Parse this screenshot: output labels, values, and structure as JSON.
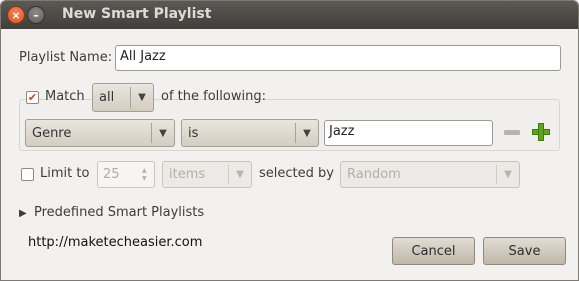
{
  "window": {
    "title": "New Smart Playlist",
    "close_glyph": "×",
    "minimize_glyph": "–"
  },
  "name_row": {
    "label": "Playlist Name:",
    "value": "All Jazz"
  },
  "match_row": {
    "checked": true,
    "check_glyph": "✔",
    "label": "Match",
    "mode": "all",
    "suffix": "of the following:"
  },
  "rule": {
    "field": "Genre",
    "operator": "is",
    "value": "Jazz"
  },
  "limit_row": {
    "checked": false,
    "label": "Limit to",
    "amount": "25",
    "unit": "items",
    "selected_by_label": "selected by",
    "order": "Random"
  },
  "predefined": {
    "label": "Predefined Smart Playlists"
  },
  "watermark": "http://maketecheasier.com",
  "buttons": {
    "cancel": "Cancel",
    "save": "Save"
  },
  "icons": {
    "remove_rule": "minus-icon",
    "add_rule": "plus-icon",
    "dropdown": "triangle-down-icon",
    "expander": "triangle-right-icon"
  },
  "colors": {
    "titlebar": "#4a4945",
    "close_button": "#e4622b",
    "check_mark": "#d0461b",
    "add_icon": "#5ea51c"
  }
}
